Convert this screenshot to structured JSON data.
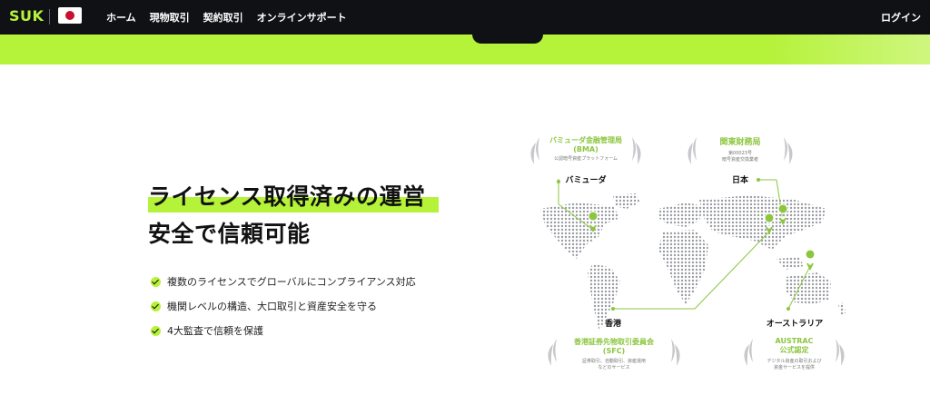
{
  "nav": {
    "logo": "SUK",
    "flag": "japan-flag",
    "items": [
      "ホーム",
      "現物取引",
      "契約取引",
      "オンラインサポート"
    ],
    "login": "ログイン"
  },
  "hero": {
    "title_line1": "ライセンス取得済みの運営",
    "title_line2": "安全で信頼可能",
    "features": [
      "複数のライセンスでグローバルにコンプライアンス対応",
      "機関レベルの構造、大口取引と資産安全を守る",
      "4大監査で信頼を保護"
    ]
  },
  "licenses": {
    "bma": {
      "title": "バミューダ金融管理局",
      "abbr": "(BMA)",
      "desc": "公認暗号資産プラットフォーム",
      "location": "バミューダ"
    },
    "japan": {
      "title": "関東財務局",
      "desc1": "第00023号",
      "desc2": "暗号資産交換業者",
      "location": "日本"
    },
    "hk": {
      "location": "香港",
      "title": "香港証券先物取引委員会",
      "abbr": "(SFC)",
      "desc1": "証券取引、自動取引、資産運用",
      "desc2": "などのサービス"
    },
    "au": {
      "location": "オーストラリア",
      "title1": "AUSTRAC",
      "title2": "公式認定",
      "desc1": "デジタル資産の取引および",
      "desc2": "資金サービスを提供"
    }
  },
  "colors": {
    "accent": "#b5f23a",
    "nav_bg": "#0f1115",
    "pin": "#8cc63f"
  }
}
